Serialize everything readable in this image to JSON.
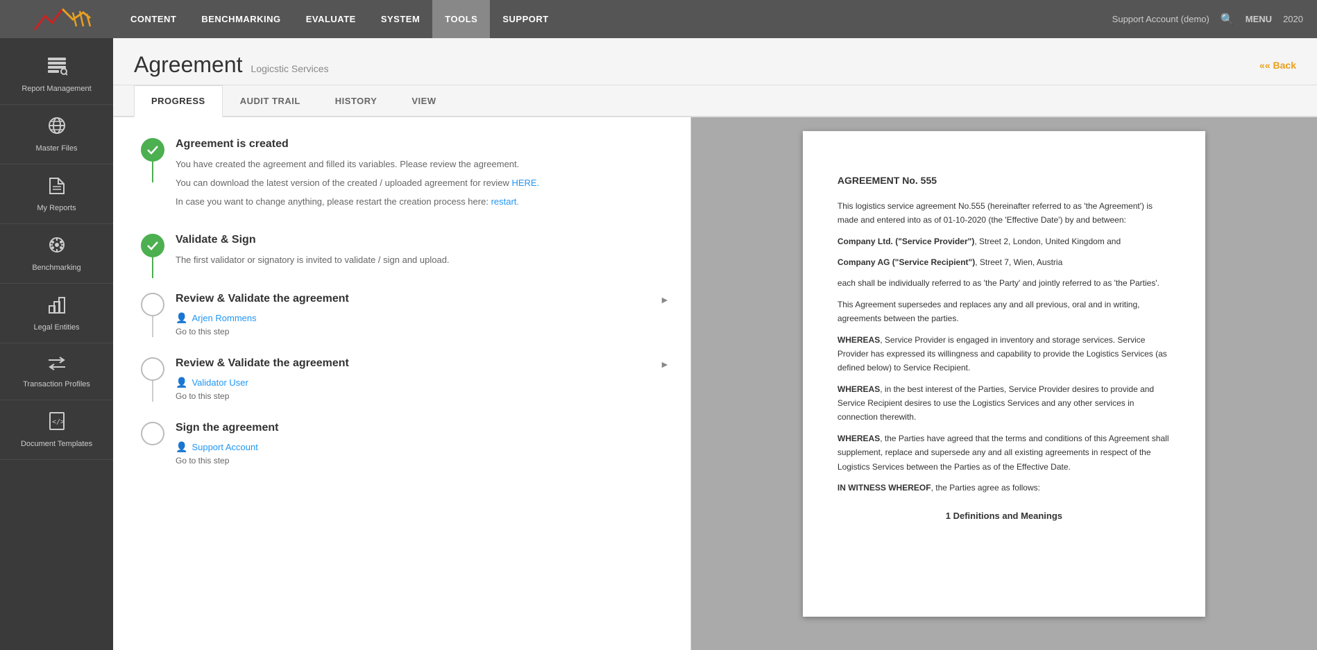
{
  "topnav": {
    "links": [
      {
        "id": "content",
        "label": "CONTENT"
      },
      {
        "id": "benchmarking",
        "label": "BENCHMARKING"
      },
      {
        "id": "evaluate",
        "label": "EVALUATE"
      },
      {
        "id": "system",
        "label": "SYSTEM"
      },
      {
        "id": "tools",
        "label": "TOOLS"
      },
      {
        "id": "support",
        "label": "SUPPORT"
      }
    ],
    "user": "Support Account (demo)",
    "year": "2020",
    "menu_label": "MENU"
  },
  "sidebar": {
    "items": [
      {
        "id": "report-management",
        "label": "Report Management",
        "icon": "≡"
      },
      {
        "id": "master-files",
        "label": "Master Files",
        "icon": "🌐"
      },
      {
        "id": "my-reports",
        "label": "My Reports",
        "icon": "📁"
      },
      {
        "id": "benchmarking",
        "label": "Benchmarking",
        "icon": "🤖"
      },
      {
        "id": "legal-entities",
        "label": "Legal Entities",
        "icon": "📊"
      },
      {
        "id": "transaction-profiles",
        "label": "Transaction Profiles",
        "icon": "⇄"
      },
      {
        "id": "document-templates",
        "label": "Document Templates",
        "icon": "</>"
      }
    ]
  },
  "page": {
    "title": "Agreement",
    "subtitle": "Logicstic Services",
    "back_label": "Back"
  },
  "tabs": [
    {
      "id": "progress",
      "label": "PROGRESS",
      "active": true
    },
    {
      "id": "audit-trail",
      "label": "AUDIT TRAIL",
      "active": false
    },
    {
      "id": "history",
      "label": "HISTORY",
      "active": false
    },
    {
      "id": "view",
      "label": "VIEW",
      "active": false
    }
  ],
  "progress_steps": [
    {
      "id": "step-created",
      "title": "Agreement is created",
      "done": true,
      "desc1": "You have created the agreement and filled its variables. Please review the agreement.",
      "desc2": "You can download the latest version of the created / uploaded agreement for review",
      "link_label": "HERE.",
      "desc3": "In case you want to change anything, please restart the creation process here:",
      "restart_label": "restart.",
      "has_line": true,
      "line_done": true
    },
    {
      "id": "step-validate-sign",
      "title": "Validate & Sign",
      "done": true,
      "desc1": "The first validator or signatory is invited to validate / sign and upload.",
      "has_line": true,
      "line_done": true
    },
    {
      "id": "step-review1",
      "title": "Review & Validate the agreement",
      "done": false,
      "user": "Arjen Rommens",
      "go_to_step": "Go to this step",
      "has_send": true,
      "has_line": true,
      "line_done": false
    },
    {
      "id": "step-review2",
      "title": "Review & Validate the agreement",
      "done": false,
      "user": "Validator User",
      "go_to_step": "Go to this step",
      "has_send": true,
      "has_line": true,
      "line_done": false
    },
    {
      "id": "step-sign",
      "title": "Sign the agreement",
      "done": false,
      "user": "Support Account",
      "go_to_step": "Go to this step",
      "has_send": false,
      "has_line": false,
      "line_done": false
    }
  ],
  "document": {
    "title": "AGREEMENT No. 555",
    "intro": "This logistics service agreement No.555 (hereinafter referred to as 'the Agreement') is made and entered into as of 01-10-2020 (the 'Effective Date') by and between:",
    "party1": "Company Ltd. (\"Service Provider\")",
    "party1_rest": ", Street 2, London, United Kingdom and",
    "party2": "Company AG (\"Service Recipient\")",
    "party2_rest": ", Street 7, Wien, Austria",
    "para1": "each shall be individually referred to as 'the Party' and jointly referred to as 'the Parties'.",
    "para2": "This Agreement supersedes and replaces any and all previous, oral and in writing, agreements between the parties.",
    "whereas1_bold": "WHEREAS",
    "whereas1_rest": ", Service Provider is engaged in inventory and storage services. Service Provider has expressed its willingness and capability to provide the Logistics Services (as defined below) to Service Recipient.",
    "whereas2_bold": "WHEREAS",
    "whereas2_rest": ", in the best interest of the Parties, Service Provider desires to provide and Service Recipient desires to use the Logistics Services and any other services in connection therewith.",
    "whereas3_bold": "WHEREAS",
    "whereas3_rest": ", the Parties have agreed that the terms and conditions of this Agreement shall supplement, replace and supersede any and all existing agreements in respect of the Logistics Services between the Parties as of the Effective Date.",
    "witness": "IN WITNESS WHEREOF",
    "witness_rest": ", the Parties agree as follows:",
    "section1": "1 Definitions and Meanings"
  }
}
